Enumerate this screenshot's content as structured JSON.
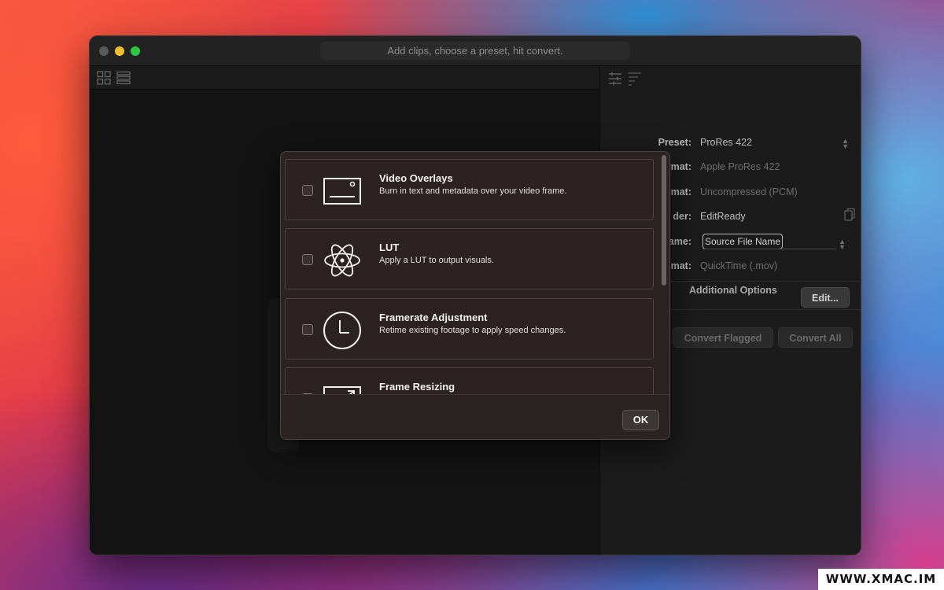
{
  "window": {
    "title_hint": "Add clips, choose a preset, hit convert."
  },
  "settings": {
    "preset_label": "Preset:",
    "preset_value": "ProRes 422",
    "video_format_label": "Video Format:",
    "video_format_value": "Apple ProRes 422",
    "audio_format_label": "mat:",
    "audio_format_value": "Uncompressed (PCM)",
    "folder_label": "der:",
    "folder_value": "EditReady",
    "name_label": "ame:",
    "name_value": "Source File Name",
    "container_label": "mat:",
    "container_value": "QuickTime (.mov)",
    "additional_options_label": "Additional Options",
    "edit_button": "Edit...",
    "convert_flagged_button": "Convert Flagged",
    "convert_all_button": "Convert All"
  },
  "modal": {
    "options": [
      {
        "title": "Video Overlays",
        "description": "Burn in text and metadata over your video frame.",
        "icon": "video-overlay-icon"
      },
      {
        "title": "LUT",
        "description": "Apply a LUT to output visuals.",
        "icon": "atom-icon"
      },
      {
        "title": "Framerate Adjustment",
        "description": "Retime existing footage to apply speed changes.",
        "icon": "clock-icon"
      },
      {
        "title": "Frame Resizing",
        "description": "",
        "icon": "resize-icon"
      }
    ],
    "ok_button": "OK"
  },
  "watermark": "WWW.XMAC.IM"
}
